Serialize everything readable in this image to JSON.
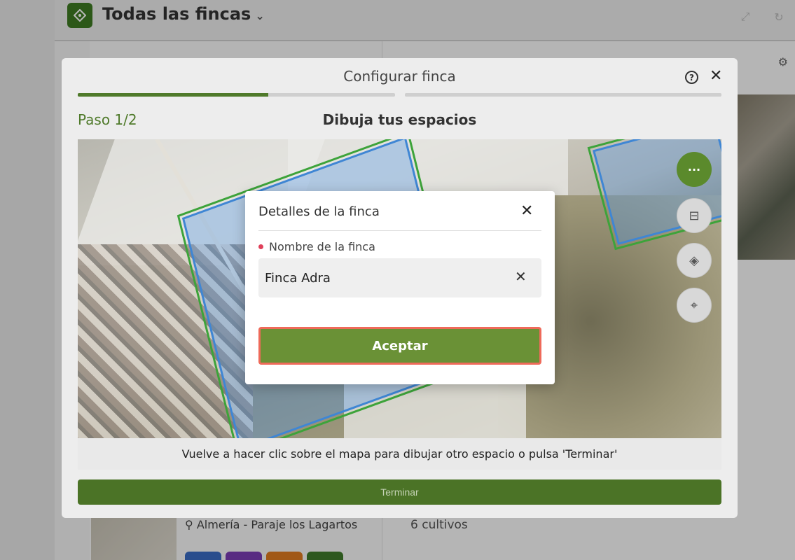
{
  "app": {
    "title": "Todas las fincas",
    "title_chevron": "⌄",
    "expand_icon": "⤢",
    "refresh_icon": "↻"
  },
  "background": {
    "location": "Almería - Paraje los Lagartos",
    "crops": "6 cultivos"
  },
  "modal": {
    "title": "Configurar finca",
    "help_glyph": "?",
    "close_glyph": "✕",
    "progress": [
      0.6,
      0.0
    ],
    "step_label": "Paso 1/2",
    "step_title": "Dibuja tus espacios",
    "hint": "Vuelve a hacer clic sobre el mapa para dibujar otro espacio o pulsa 'Terminar'",
    "finish_label": "Terminar",
    "map_buttons": [
      {
        "name": "more-options",
        "glyph": "···"
      },
      {
        "name": "edit-shapes",
        "glyph": "⊟"
      },
      {
        "name": "layers",
        "glyph": "◈"
      },
      {
        "name": "locate",
        "glyph": "⌖"
      }
    ]
  },
  "dialog": {
    "title": "Detalles de la finca",
    "close_glyph": "✕",
    "field_label": "Nombre de la finca",
    "field_value": "Finca Adra",
    "clear_glyph": "✕",
    "accept_label": "Aceptar"
  },
  "colors": {
    "brand_green": "#5b8a2c",
    "accept_green": "#6a9136",
    "focus_ring": "#ef6a5a",
    "required_dot": "#e0405a",
    "polygon_blue": "#3f86d4"
  }
}
